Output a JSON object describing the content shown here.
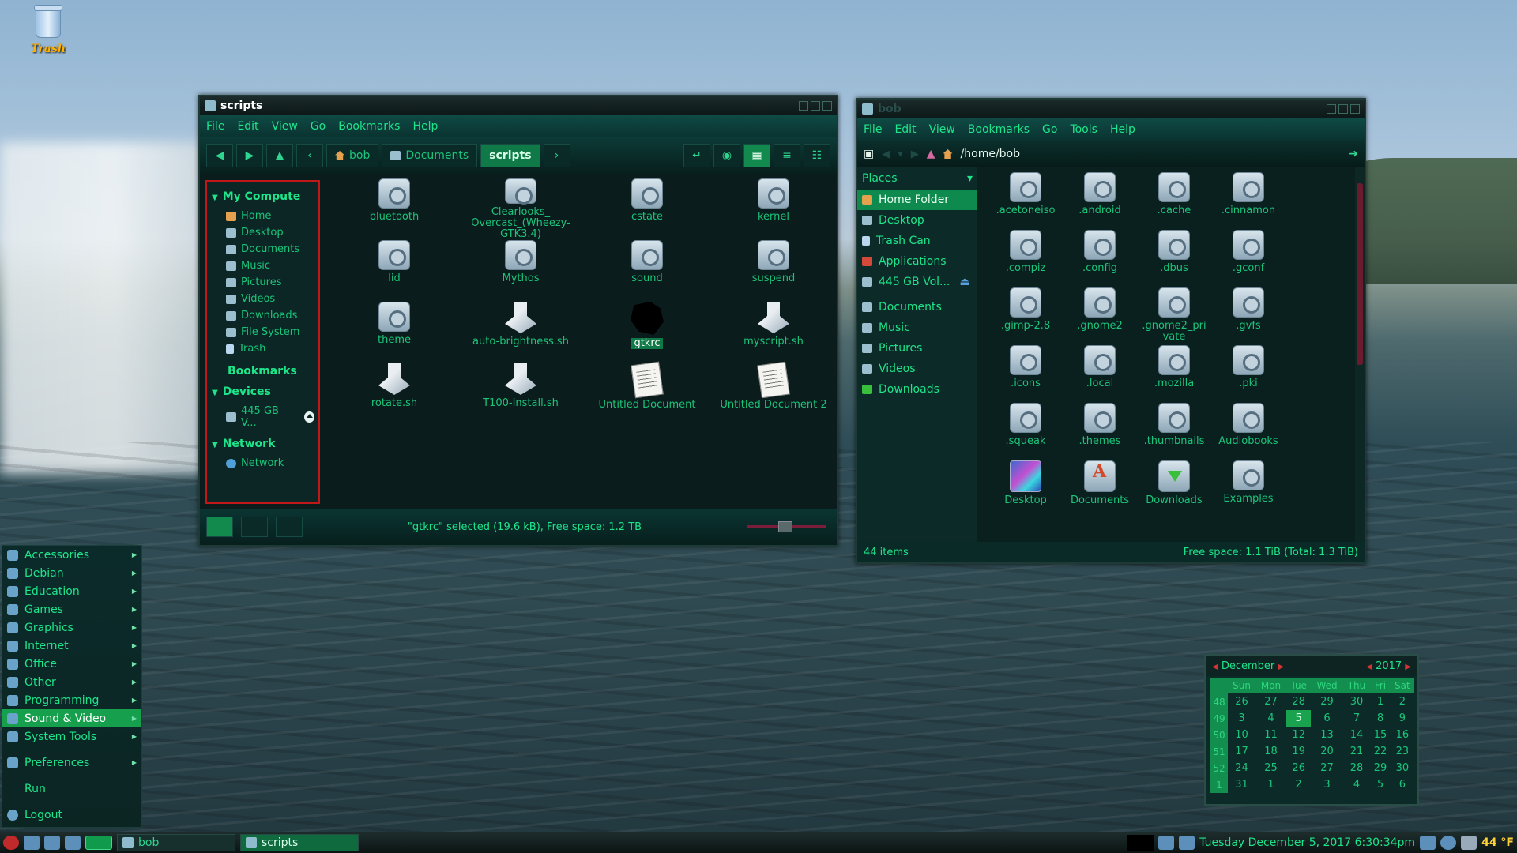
{
  "desktop": {
    "trash_label": "Trash"
  },
  "left_window": {
    "title": "scripts",
    "menu": [
      "File",
      "Edit",
      "View",
      "Go",
      "Bookmarks",
      "Help"
    ],
    "breadcrumbs": [
      "bob",
      "Documents",
      "scripts"
    ],
    "sidebar": {
      "my_computer": "My Compute",
      "items": [
        "Home",
        "Desktop",
        "Documents",
        "Music",
        "Pictures",
        "Videos",
        "Downloads",
        "File System",
        "Trash"
      ],
      "bookmarks": "Bookmarks",
      "devices": "Devices",
      "device_item": "445 GB V...",
      "network": "Network",
      "network_item": "Network"
    },
    "files": [
      {
        "name": "bluetooth",
        "kind": "folder"
      },
      {
        "name": "Clearlooks_ Overcast_(Wheezy-GTK3.4)",
        "kind": "folder"
      },
      {
        "name": "cstate",
        "kind": "folder"
      },
      {
        "name": "kernel",
        "kind": "folder"
      },
      {
        "name": "lid",
        "kind": "folder"
      },
      {
        "name": "Mythos",
        "kind": "folder"
      },
      {
        "name": "sound",
        "kind": "folder"
      },
      {
        "name": "suspend",
        "kind": "folder"
      },
      {
        "name": "theme",
        "kind": "folder"
      },
      {
        "name": "auto-brightness.sh",
        "kind": "script"
      },
      {
        "name": "gtkrc",
        "kind": "black",
        "selected": true
      },
      {
        "name": "myscript.sh",
        "kind": "script"
      },
      {
        "name": "rotate.sh",
        "kind": "script"
      },
      {
        "name": "T100-Install.sh",
        "kind": "script"
      },
      {
        "name": "Untitled Document",
        "kind": "text"
      },
      {
        "name": "Untitled Document 2",
        "kind": "text"
      }
    ],
    "status": "\"gtkrc\" selected (19.6 kB), Free space: 1.2 TB"
  },
  "right_window": {
    "title": "bob",
    "menu": [
      "File",
      "Edit",
      "View",
      "Bookmarks",
      "Go",
      "Tools",
      "Help"
    ],
    "path": "/home/bob",
    "places_header": "Places",
    "places": [
      "Home Folder",
      "Desktop",
      "Trash Can",
      "Applications",
      "445 GB Vol...",
      "Documents",
      "Music",
      "Pictures",
      "Videos",
      "Downloads"
    ],
    "files": [
      {
        "name": ".acetoneiso",
        "kind": "folder"
      },
      {
        "name": ".android",
        "kind": "folder"
      },
      {
        "name": ".cache",
        "kind": "folder"
      },
      {
        "name": ".cinnamon",
        "kind": "folder"
      },
      {
        "name": ".compiz",
        "kind": "folder"
      },
      {
        "name": ".config",
        "kind": "folder"
      },
      {
        "name": ".dbus",
        "kind": "folder"
      },
      {
        "name": ".gconf",
        "kind": "folder"
      },
      {
        "name": ".gimp-2.8",
        "kind": "folder"
      },
      {
        "name": ".gnome2",
        "kind": "folder"
      },
      {
        "name": ".gnome2_pri vate",
        "kind": "folder"
      },
      {
        "name": ".gvfs",
        "kind": "folder"
      },
      {
        "name": ".icons",
        "kind": "folder"
      },
      {
        "name": ".local",
        "kind": "folder"
      },
      {
        "name": ".mozilla",
        "kind": "folder"
      },
      {
        "name": ".pki",
        "kind": "folder"
      },
      {
        "name": ".squeak",
        "kind": "folder"
      },
      {
        "name": ".themes",
        "kind": "folder"
      },
      {
        "name": ".thumbnails",
        "kind": "folder"
      },
      {
        "name": "Audiobooks",
        "kind": "folder"
      },
      {
        "name": "Desktop",
        "kind": "app"
      },
      {
        "name": "Documents",
        "kind": "doc"
      },
      {
        "name": "Downloads",
        "kind": "dl"
      },
      {
        "name": "Examples",
        "kind": "folder"
      }
    ],
    "items_count": "44 items",
    "free_space": "Free space: 1.1 TiB (Total: 1.3 TiB)"
  },
  "start_menu": {
    "items": [
      "Accessories",
      "Debian",
      "Education",
      "Games",
      "Graphics",
      "Internet",
      "Office",
      "Other",
      "Programming",
      "Sound & Video",
      "System Tools"
    ],
    "selected": "Sound & Video",
    "preferences": "Preferences",
    "run": "Run",
    "logout": "Logout"
  },
  "calendar": {
    "month": "December",
    "year": "2017",
    "weekdays": [
      "Sun",
      "Mon",
      "Tue",
      "Wed",
      "Thu",
      "Fri",
      "Sat"
    ],
    "weeks": [
      {
        "wk": "48",
        "days": [
          "26",
          "27",
          "28",
          "29",
          "30",
          "1",
          "2"
        ]
      },
      {
        "wk": "49",
        "days": [
          "3",
          "4",
          "5",
          "6",
          "7",
          "8",
          "9"
        ]
      },
      {
        "wk": "50",
        "days": [
          "10",
          "11",
          "12",
          "13",
          "14",
          "15",
          "16"
        ]
      },
      {
        "wk": "51",
        "days": [
          "17",
          "18",
          "19",
          "20",
          "21",
          "22",
          "23"
        ]
      },
      {
        "wk": "52",
        "days": [
          "24",
          "25",
          "26",
          "27",
          "28",
          "29",
          "30"
        ]
      },
      {
        "wk": "1",
        "days": [
          "31",
          "1",
          "2",
          "3",
          "4",
          "5",
          "6"
        ]
      }
    ],
    "today": "5"
  },
  "taskbar": {
    "tasks": [
      "bob",
      "scripts"
    ],
    "active_task": "scripts",
    "clock": "Tuesday December  5, 2017  6:30:34pm",
    "weather": "44 °F"
  },
  "colors": {
    "accent": "#1ee48a",
    "selection": "#0f8a4e",
    "highlight_red": "#c01818"
  }
}
